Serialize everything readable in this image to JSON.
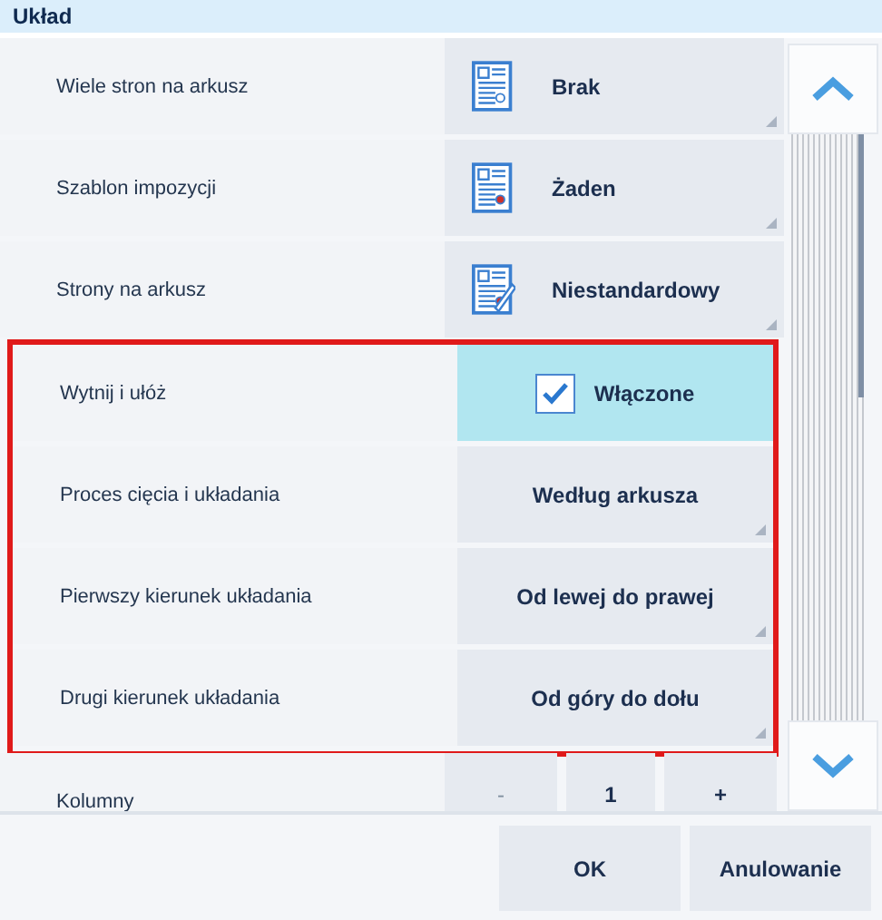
{
  "header": {
    "title": "Układ"
  },
  "setting_groups": [
    {
      "highlighted": false,
      "settings": [
        {
          "label": "Wiele stron na arkusz",
          "kind": "dropdown",
          "has_icon": true,
          "value": "Brak"
        },
        {
          "label": "Szablon impozycji",
          "kind": "dropdown",
          "has_icon": true,
          "value": "Żaden"
        },
        {
          "label": "Strony na arkusz",
          "kind": "dropdown",
          "has_icon": true,
          "value": "Niestandardowy"
        }
      ]
    },
    {
      "highlighted": true,
      "settings": [
        {
          "label": "Wytnij i ułóż",
          "kind": "checkbox",
          "checked": true,
          "value": "Włączone"
        },
        {
          "label": "Proces cięcia i układania",
          "kind": "dropdown",
          "has_icon": false,
          "value": "Według arkusza"
        },
        {
          "label": "Pierwszy kierunek układania",
          "kind": "dropdown",
          "has_icon": false,
          "value": "Od lewej do prawej"
        },
        {
          "label": "Drugi kierunek układania",
          "kind": "dropdown",
          "has_icon": false,
          "value": "Od góry do dołu"
        }
      ]
    },
    {
      "highlighted": false,
      "settings": [
        {
          "label": "Kolumny",
          "kind": "stepper",
          "minus": "-",
          "value": "1",
          "plus": "+"
        }
      ]
    }
  ],
  "buttons": [
    "OK",
    "Anulowanie"
  ]
}
